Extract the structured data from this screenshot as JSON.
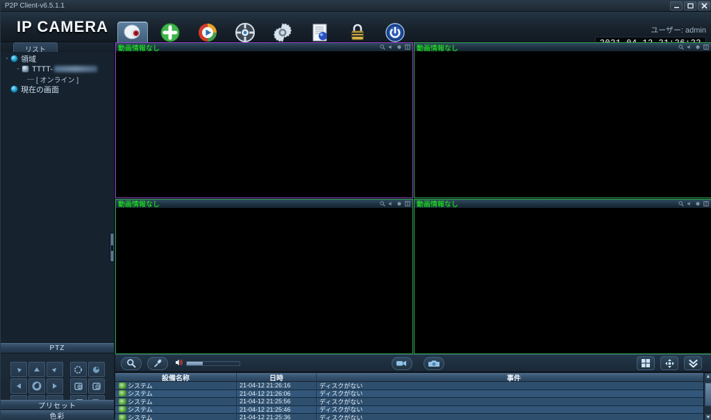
{
  "window": {
    "title": "P2P Client-v6.5.1.1",
    "minimize_label": "minimize",
    "maximize_label": "maximize",
    "close_label": "close"
  },
  "header": {
    "logo_text": "IP CAMERA",
    "user_label": "ユーザー: admin",
    "clock": "2021-04-12 21:26:22",
    "toolbar": [
      {
        "name": "camera-view-icon",
        "label": "カメラ",
        "selected": true
      },
      {
        "name": "add-device-icon",
        "label": "追加",
        "selected": false
      },
      {
        "name": "playback-icon",
        "label": "再生",
        "selected": false
      },
      {
        "name": "record-reel-icon",
        "label": "録画",
        "selected": false
      },
      {
        "name": "settings-gear-icon",
        "label": "設定",
        "selected": false
      },
      {
        "name": "log-document-icon",
        "label": "ログ",
        "selected": false
      },
      {
        "name": "lock-icon",
        "label": "ロック",
        "selected": false
      },
      {
        "name": "power-icon",
        "label": "終了",
        "selected": false
      }
    ]
  },
  "sidebar": {
    "tab_label": "リスト",
    "tree": {
      "root_label": "領域",
      "device_label": "TTTT-",
      "status_label": "[ オンライン ]",
      "current_screen_label": "現在の画面"
    },
    "sections": {
      "ptz": "PTZ",
      "preset": "プリセット",
      "color": "色彩"
    },
    "ptz_buttons": [
      {
        "name": "ptz-up-left",
        "icon": "arrow-up-left"
      },
      {
        "name": "ptz-up",
        "icon": "arrow-up"
      },
      {
        "name": "ptz-up-right",
        "icon": "arrow-up-right"
      },
      {
        "name": "ptz-left",
        "icon": "arrow-left"
      },
      {
        "name": "ptz-auto-scan",
        "icon": "rotate"
      },
      {
        "name": "ptz-right",
        "icon": "arrow-right"
      },
      {
        "name": "ptz-down-left",
        "icon": "arrow-down-left"
      },
      {
        "name": "ptz-down",
        "icon": "arrow-down"
      },
      {
        "name": "ptz-down-right",
        "icon": "arrow-down-right"
      }
    ],
    "ptz_lens_buttons": [
      {
        "name": "iris-open",
        "icon": "iris-open"
      },
      {
        "name": "iris-close",
        "icon": "iris-close"
      },
      {
        "name": "zoom-in",
        "icon": "zoom-in"
      },
      {
        "name": "zoom-out",
        "icon": "zoom-out"
      },
      {
        "name": "focus-near",
        "icon": "focus-near"
      },
      {
        "name": "focus-far",
        "icon": "focus-far"
      }
    ]
  },
  "video": {
    "panes": [
      {
        "title": "動画情報なし",
        "selected": true
      },
      {
        "title": "動画情報なし",
        "selected": false
      },
      {
        "title": "動画情報なし",
        "selected": false
      },
      {
        "title": "動画情報なし",
        "selected": false
      }
    ],
    "pane_icons": [
      "zoom-icon",
      "speaker-icon",
      "record-icon",
      "grid-icon"
    ]
  },
  "controlbar": {
    "search_label": "検索",
    "mic_label": "マイク",
    "volume_percent": 30,
    "record_label": "録画",
    "snapshot_label": "スナップ",
    "layout_label": "画面分割",
    "fullscreen_label": "全画面",
    "expand_label": "展開"
  },
  "log": {
    "columns": [
      "設備名称",
      "日時",
      "事件"
    ],
    "rows": [
      {
        "device": "システム",
        "datetime": "21-04-12 21:26:16",
        "event": "ディスクがない"
      },
      {
        "device": "システム",
        "datetime": "21-04-12 21:26:06",
        "event": "ディスクがない"
      },
      {
        "device": "システム",
        "datetime": "21-04-12 21:25:56",
        "event": "ディスクがない"
      },
      {
        "device": "システム",
        "datetime": "21-04-12 21:25:46",
        "event": "ディスクがない"
      },
      {
        "device": "システム",
        "datetime": "21-04-12 21:25:36",
        "event": "ディスクがない"
      }
    ],
    "scroll_up": "▲",
    "scroll_down": "▼"
  },
  "colors": {
    "selected_pane_border": "#9a3fd0",
    "pane_border": "#2fa84f",
    "pane_title_text": "#25ef25",
    "accent": "#4a7ba7"
  }
}
